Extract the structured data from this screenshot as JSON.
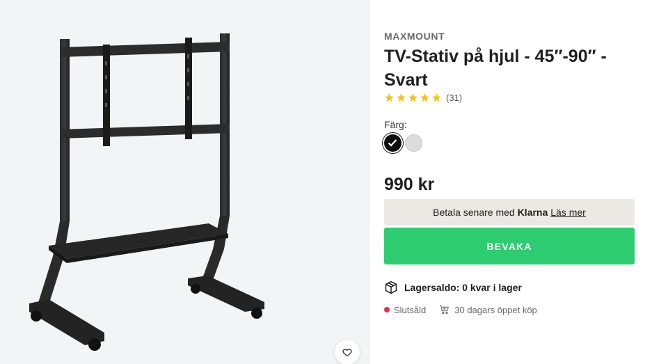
{
  "gallery": {
    "wishlist_icon": "heart-icon"
  },
  "product": {
    "brand": "MAXMOUNT",
    "title": "TV-Stativ på hjul - 45″-90″ - Svart",
    "rating": {
      "stars": 5,
      "count_text": "(31)"
    },
    "color_label": "Färg:",
    "colors": [
      {
        "name": "Svart",
        "hex": "#0e0e0e",
        "selected": true
      },
      {
        "name": "Grå",
        "hex": "#dcdcdc",
        "selected": false
      }
    ],
    "price": "990 kr"
  },
  "klarna": {
    "prefix": "Betala senare med",
    "brand": "Klarna",
    "link": "Läs mer"
  },
  "watch_button": {
    "label": "BEVAKA",
    "color": "#2ecc71"
  },
  "stock": {
    "label": "Lagersaldo: 0 kvar i lager",
    "icon": "box-icon"
  },
  "meta": {
    "status": "Slutsåld",
    "status_color": "#e0314f",
    "returns": "30 dagars öppet köp",
    "returns_icon": "cart-return-icon"
  }
}
